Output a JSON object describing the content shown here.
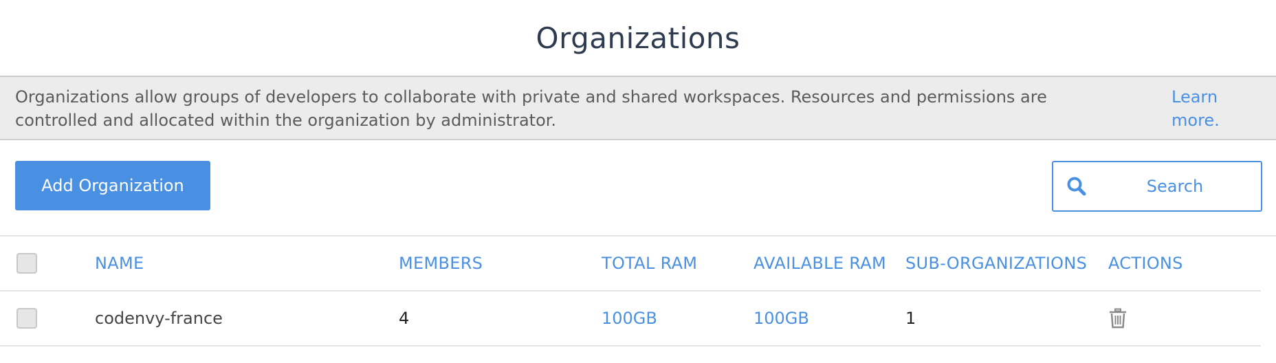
{
  "page": {
    "title": "Organizations"
  },
  "banner": {
    "text": "Organizations allow groups of developers to collaborate with private and shared workspaces. Resources and permissions are controlled and allocated within the organization by administrator.",
    "learn_more": "Learn more."
  },
  "toolbar": {
    "add_label": "Add Organization",
    "search_placeholder": "Search"
  },
  "table": {
    "headers": {
      "name": "NAME",
      "members": "MEMBERS",
      "total_ram": "TOTAL RAM",
      "available_ram": "AVAILABLE RAM",
      "sub_organizations": "SUB-ORGANIZATIONS",
      "actions": "ACTIONS"
    },
    "rows": [
      {
        "name": "codenvy-france",
        "members": "4",
        "total_ram": "100GB",
        "available_ram": "100GB",
        "sub_organizations": "1",
        "action_icon": "trash-icon"
      }
    ]
  },
  "colors": {
    "accent": "#4a90e2",
    "banner_bg": "#ececec",
    "title": "#2e3a4e"
  }
}
